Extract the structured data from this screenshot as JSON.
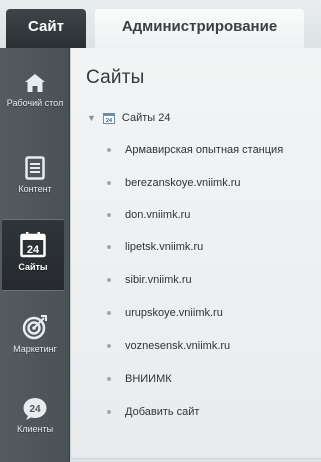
{
  "tabs": {
    "site_label": "Сайт",
    "admin_label": "Администрирование"
  },
  "sidebar": {
    "items": [
      {
        "label": "Рабочий стол",
        "icon": "home-icon",
        "active": false
      },
      {
        "label": "Контент",
        "icon": "document-icon",
        "active": false
      },
      {
        "label": "Сайты",
        "icon": "calendar-24-icon",
        "active": true
      },
      {
        "label": "Маркетинг",
        "icon": "target-icon",
        "active": false
      },
      {
        "label": "Клиенты",
        "icon": "clients-24-icon",
        "active": false
      }
    ]
  },
  "main": {
    "title": "Сайты",
    "root": {
      "label": "Сайты 24",
      "icon": "calendar-24-icon",
      "expanded": true
    },
    "sites": [
      "Армавирская опытная станция",
      "berezanskoye.vniimk.ru",
      "don.vniimk.ru",
      "lipetsk.vniimk.ru",
      "sibir.vniimk.ru",
      "urupskoye.vniimk.ru",
      "voznesensk.vniimk.ru",
      "ВНИИМК",
      "Добавить сайт"
    ]
  },
  "colors": {
    "sidebar_bg": "#50575c",
    "active_nav_bg": "#2b3034",
    "main_bg": "#eef1f2",
    "text": "#2f3538"
  }
}
